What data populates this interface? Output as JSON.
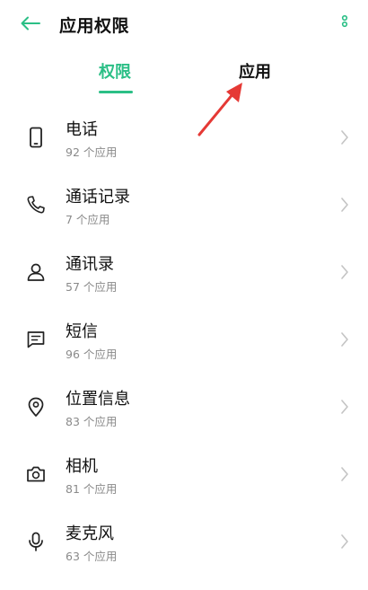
{
  "header": {
    "title": "应用权限",
    "back_icon": "arrow-left-icon",
    "more_icon": "more-vertical-icon"
  },
  "tabs": [
    {
      "label": "权限",
      "active": true
    },
    {
      "label": "应用",
      "active": false
    }
  ],
  "colors": {
    "accent": "#2bbf86",
    "annotation": "#e53935",
    "secondary_text": "#8a8a8a",
    "chevron": "#c4c4c4"
  },
  "permissions": [
    {
      "name": "电话",
      "count": "92 个应用",
      "icon": "phone-device-icon"
    },
    {
      "name": "通话记录",
      "count": "7 个应用",
      "icon": "call-handset-icon"
    },
    {
      "name": "通讯录",
      "count": "57 个应用",
      "icon": "contact-person-icon"
    },
    {
      "name": "短信",
      "count": "96 个应用",
      "icon": "message-icon"
    },
    {
      "name": "位置信息",
      "count": "83 个应用",
      "icon": "location-pin-icon"
    },
    {
      "name": "相机",
      "count": "81 个应用",
      "icon": "camera-icon"
    },
    {
      "name": "麦克风",
      "count": "63 个应用",
      "icon": "microphone-icon"
    }
  ]
}
